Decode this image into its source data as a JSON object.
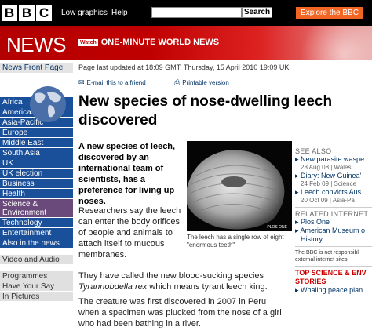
{
  "header": {
    "logo_letters": [
      "B",
      "B",
      "C"
    ],
    "low_graphics": "Low graphics",
    "help": "Help",
    "search_value": "",
    "search_button": "Search",
    "explore": "Explore the BBC"
  },
  "banner": {
    "title": "NEWS",
    "watch": "Watch",
    "one_minute": "ONE-MINUTE WORLD NEWS"
  },
  "sidebar": {
    "front_page": "News Front Page",
    "regions": [
      "Africa",
      "Americas",
      "Asia-Pacific",
      "Europe",
      "Middle East",
      "South Asia",
      "UK",
      "UK election",
      "Business",
      "Health"
    ],
    "selected": "Science & Environment",
    "more": [
      "Technology",
      "Entertainment",
      "Also in the news"
    ],
    "media": "Video and Audio",
    "extras": [
      "Programmes",
      "Have Your Say",
      "In Pictures"
    ]
  },
  "article": {
    "updated": "Page last updated at 18:09 GMT, Thursday, 15 April 2010 19:09 UK",
    "email_link": "E-mail this to a friend",
    "print_link": "Printable version",
    "headline": "New species of nose-dwelling leech discovered",
    "intro": "A new species of leech, discovered by an international team of scientists, has a preference for living up noses.",
    "p1": "Researchers say the leech can enter the body orifices of people and animals to attach itself to mucous membranes.",
    "p2_a": "They have called the new blood-sucking species ",
    "p2_species": "Tyrannobdella rex",
    "p2_b": " which means tyrant leech king.",
    "p3": "The creature was first discovered in 2007 in Peru when a specimen was plucked from the nose of a girl who had been bathing in a river.",
    "photo_credit": "PLOS ONE",
    "caption": "The leech has a single row of eight \"enormous teeth\""
  },
  "right_column": {
    "see_also": "SEE ALSO",
    "items": [
      {
        "title": "New parasite waspe",
        "meta": "28 Aug 08 | Wales"
      },
      {
        "title": "Diary: New Guinea'",
        "meta": "24 Feb 09 | Science"
      },
      {
        "title": "Leech convicts Aus",
        "meta": "20 Oct 09 | Asia-Pa"
      }
    ],
    "related": "RELATED INTERNET",
    "links": [
      "Plos One",
      "American Museum of Natural History"
    ],
    "links_display": [
      "Plos One",
      "American Museum o",
      "History"
    ],
    "note": "The BBC is not responsibl external internet sites",
    "top_stories": "TOP SCIENCE & ENV STORIES",
    "top_item": "Whaling peace plan"
  },
  "colors": {
    "topbar": "#000000",
    "news_red": "#c00000",
    "explore": "#f26522",
    "nav_blue": "#1a4f99",
    "nav_selected": "#6a4a7a"
  }
}
